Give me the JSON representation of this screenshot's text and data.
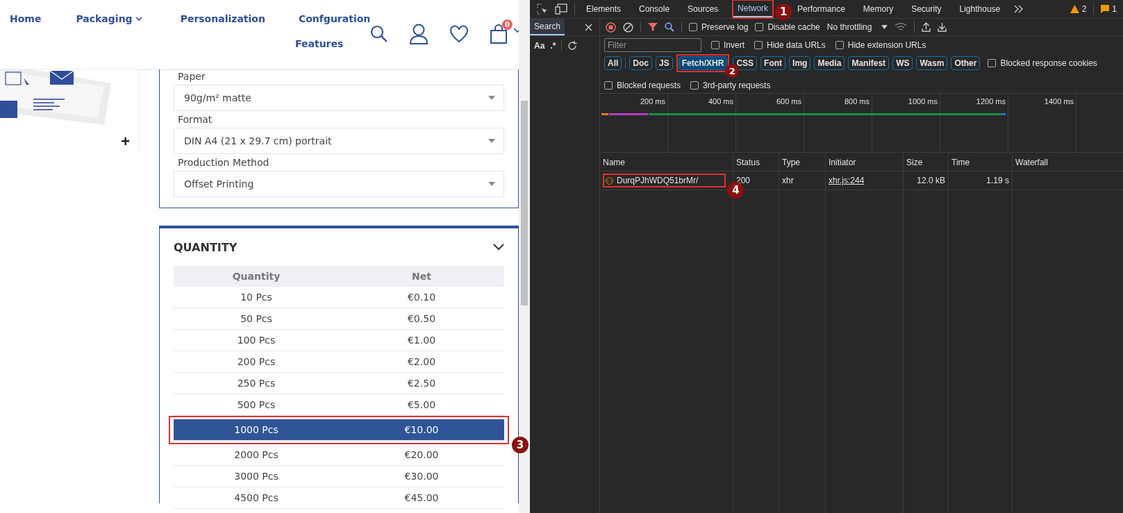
{
  "nav": {
    "items": [
      {
        "label": "Home",
        "dropdown": false
      },
      {
        "label": "Packaging",
        "dropdown": true
      },
      {
        "label": "Personalization",
        "dropdown": false
      },
      {
        "label": "Confguration",
        "dropdown": false
      },
      {
        "label": "Features",
        "dropdown": false
      }
    ],
    "cart_count": "0"
  },
  "product": {
    "zoom_button": "+"
  },
  "options": [
    {
      "label": "Paper",
      "value": "90g/m² matte"
    },
    {
      "label": "Format",
      "value": "DIN A4 (21 x 29.7 cm) portrait"
    },
    {
      "label": "Production Method",
      "value": "Offset Printing"
    }
  ],
  "quantity": {
    "title": "QUANTITY",
    "expanded": true,
    "columns": [
      "Quantity",
      "Net"
    ],
    "rows": [
      {
        "quantity": "10 Pcs",
        "net": "€0.10",
        "selected": false
      },
      {
        "quantity": "50 Pcs",
        "net": "€0.50",
        "selected": false
      },
      {
        "quantity": "100 Pcs",
        "net": "€1.00",
        "selected": false
      },
      {
        "quantity": "200 Pcs",
        "net": "€2.00",
        "selected": false
      },
      {
        "quantity": "250 Pcs",
        "net": "€2.50",
        "selected": false
      },
      {
        "quantity": "500 Pcs",
        "net": "€5.00",
        "selected": false
      },
      {
        "quantity": "1000 Pcs",
        "net": "€10.00",
        "selected": true,
        "callout": "3"
      },
      {
        "quantity": "2000 Pcs",
        "net": "€20.00",
        "selected": false
      },
      {
        "quantity": "3000 Pcs",
        "net": "€30.00",
        "selected": false
      },
      {
        "quantity": "4500 Pcs",
        "net": "€45.00",
        "selected": false
      }
    ]
  },
  "devtools": {
    "tabs": [
      {
        "label": "Elements",
        "selected": false
      },
      {
        "label": "Console",
        "selected": false
      },
      {
        "label": "Sources",
        "selected": false
      },
      {
        "label": "Network",
        "selected": true,
        "callout": "1"
      },
      {
        "label": "Performance",
        "selected": false
      },
      {
        "label": "Memory",
        "selected": false
      },
      {
        "label": "Security",
        "selected": false
      },
      {
        "label": "Lighthouse",
        "selected": false
      }
    ],
    "warnings": "2",
    "issues": "1",
    "sidebar": {
      "tab": "Search",
      "case_toggle": "Aa",
      "regex_toggle": ".*"
    },
    "toolbar": {
      "checkboxes": [
        {
          "label": "Preserve log",
          "checked": false
        },
        {
          "label": "Disable cache",
          "checked": false
        }
      ],
      "throttling": "No throttling"
    },
    "filter": {
      "placeholder": "Filter",
      "checkboxes": [
        {
          "label": "Invert",
          "checked": false
        },
        {
          "label": "Hide data URLs",
          "checked": false
        },
        {
          "label": "Hide extension URLs",
          "checked": false
        }
      ]
    },
    "chips": [
      {
        "label": "All",
        "selected": false
      },
      {
        "label": "Doc",
        "selected": false
      },
      {
        "label": "JS",
        "selected": false
      },
      {
        "label": "Fetch/XHR",
        "selected": true,
        "callout": "2"
      },
      {
        "label": "CSS",
        "selected": false
      },
      {
        "label": "Font",
        "selected": false
      },
      {
        "label": "Img",
        "selected": false
      },
      {
        "label": "Media",
        "selected": false
      },
      {
        "label": "Manifest",
        "selected": false
      },
      {
        "label": "WS",
        "selected": false
      },
      {
        "label": "Wasm",
        "selected": false
      },
      {
        "label": "Other",
        "selected": false
      }
    ],
    "chip_checkbox": {
      "label": "Blocked response cookies",
      "checked": false
    },
    "more_checkboxes": [
      {
        "label": "Blocked requests",
        "checked": false
      },
      {
        "label": "3rd-party requests",
        "checked": false
      }
    ],
    "timeline_ticks": [
      "200 ms",
      "400 ms",
      "600 ms",
      "800 ms",
      "1000 ms",
      "1200 ms",
      "1400 ms"
    ],
    "table": {
      "columns": [
        "Name",
        "Status",
        "Type",
        "Initiator",
        "Size",
        "Time",
        "Waterfall"
      ],
      "rows": [
        {
          "name": "DurqPJhWDQ51brMr/",
          "status": "200",
          "type": "xhr",
          "initiator": "xhr.js:244",
          "size": "12.0 kB",
          "time": "1.19 s",
          "callout": "4"
        }
      ]
    }
  }
}
